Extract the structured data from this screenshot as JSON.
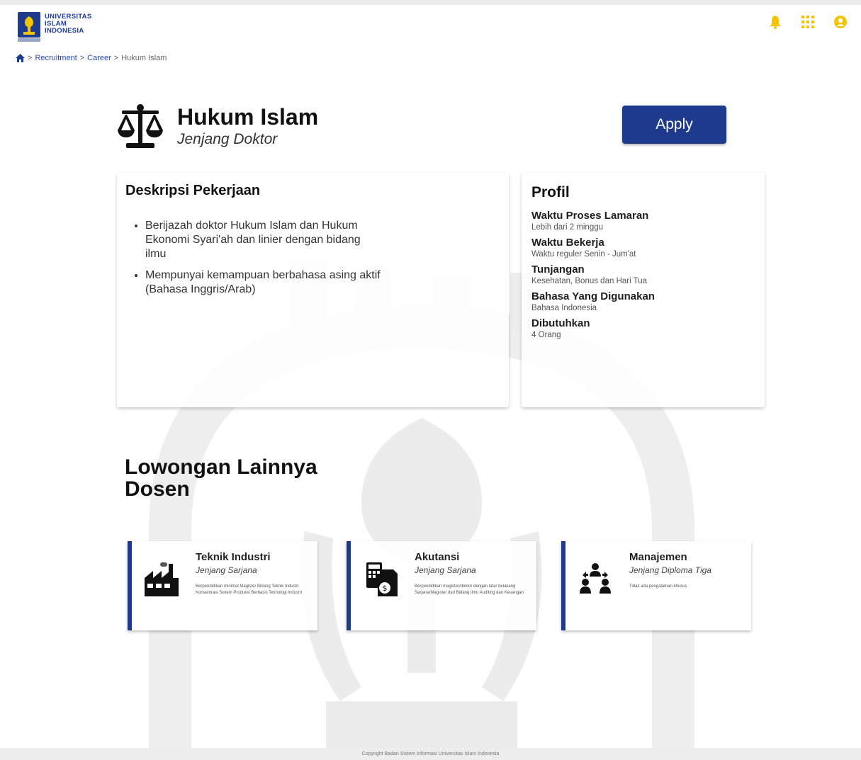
{
  "header": {
    "logo_lines": [
      "UNIVERSITAS",
      "ISLAM",
      "INDONESIA"
    ],
    "icons": [
      "bell-icon",
      "grid-apps-icon",
      "user-circle-icon"
    ],
    "accent_color": "#f5c400"
  },
  "breadcrumb": {
    "home_icon": "home-icon",
    "items": [
      "Recruitment",
      "Career",
      "Hukum Islam"
    ],
    "separator": ">"
  },
  "job": {
    "icon": "scales-of-justice-icon",
    "title": "Hukum Islam",
    "level": "Jenjang Doktor",
    "apply_label": "Apply",
    "brand_color": "#1e3a8c"
  },
  "description": {
    "heading": "Deskripsi Pekerjaan",
    "items": [
      "Berijazah doktor Hukum Islam dan Hukum Ekonomi Syari'ah dan linier dengan bidang ilmu",
      "Mempunyai kemampuan berbahasa asing aktif (Bahasa Inggris/Arab)"
    ]
  },
  "profile": {
    "heading": "Profil",
    "items": [
      {
        "label": "Waktu Proses Lamaran",
        "value": "Lebih dari 2 minggu"
      },
      {
        "label": "Waktu Bekerja",
        "value": "Waktu reguler Senin - Jum'at"
      },
      {
        "label": "Tunjangan",
        "value": "Kesehatan, Bonus dan Hari Tua"
      },
      {
        "label": "Bahasa Yang Digunakan",
        "value": "Bahasa Indonesia"
      },
      {
        "label": "Dibutuhkan",
        "value": "4 Orang"
      }
    ]
  },
  "other": {
    "title_line1": "Lowongan Lainnya",
    "title_line2": "Dosen",
    "cards": [
      {
        "icon": "factory-icon",
        "title": "Teknik Industri",
        "level": "Jenjang Sarjana",
        "desc": "Berpendidikan minimal Magister Bidang Teknik Industri Konsentrasi Sistem Produksi Berbasis Teknologi Industri"
      },
      {
        "icon": "accounting-calculator-icon",
        "title": "Akutansi",
        "level": "Jenjang Sarjana",
        "desc": "Berpendidikan magister/doktor dengan latar belakang Sarjana/Magister dari Bidang Ilmu Auditing dan Keuangan"
      },
      {
        "icon": "people-management-icon",
        "title": "Manajemen",
        "level": "Jenjang Diploma Tiga",
        "desc": "Tidak ada pengalaman khusus"
      }
    ]
  },
  "footer": {
    "text": "Copyright Badan Sistem Informasi Universitas Islam Indonesia"
  }
}
